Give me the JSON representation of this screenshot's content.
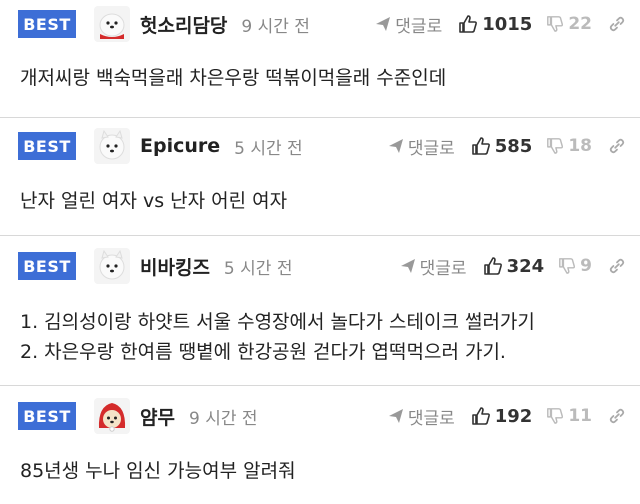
{
  "comments": [
    {
      "badge": "BEST",
      "author": "헛소리담당",
      "time": "9 시간 전",
      "reply_label": "댓글로",
      "likes": "1015",
      "dislikes": "22",
      "avatar": "samoyed-red-scarf",
      "lines": [
        "개저씨랑 백숙먹을래 차은우랑 떡볶이먹을래 수준인데"
      ]
    },
    {
      "badge": "BEST",
      "author": "Epicure",
      "time": "5 시간 전",
      "reply_label": "댓글로",
      "likes": "585",
      "dislikes": "18",
      "avatar": "samoyed",
      "lines": [
        "난자 얼린 여자 vs 난자 어린 여자"
      ]
    },
    {
      "badge": "BEST",
      "author": "비바킹즈",
      "time": "5 시간 전",
      "reply_label": "댓글로",
      "likes": "324",
      "dislikes": "9",
      "avatar": "samoyed",
      "lines": [
        "1. 김의성이랑 하얏트 서울 수영장에서 놀다가 스테이크 썰러가기",
        "2. 차은우랑 한여름 땡볕에 한강공원 걷다가 엽떡먹으러 가기."
      ]
    },
    {
      "badge": "BEST",
      "author": "얌무",
      "time": "9 시간 전",
      "reply_label": "댓글로",
      "likes": "192",
      "dislikes": "11",
      "avatar": "puppy-red-hood",
      "lines": [
        "85년생 누나 임신 가능여부 알려줘"
      ]
    }
  ],
  "colors": {
    "badge": "#3d6ed6",
    "meta_text": "#888888",
    "dislike_text": "#bbbbbb",
    "divider": "#d8d8d8"
  }
}
